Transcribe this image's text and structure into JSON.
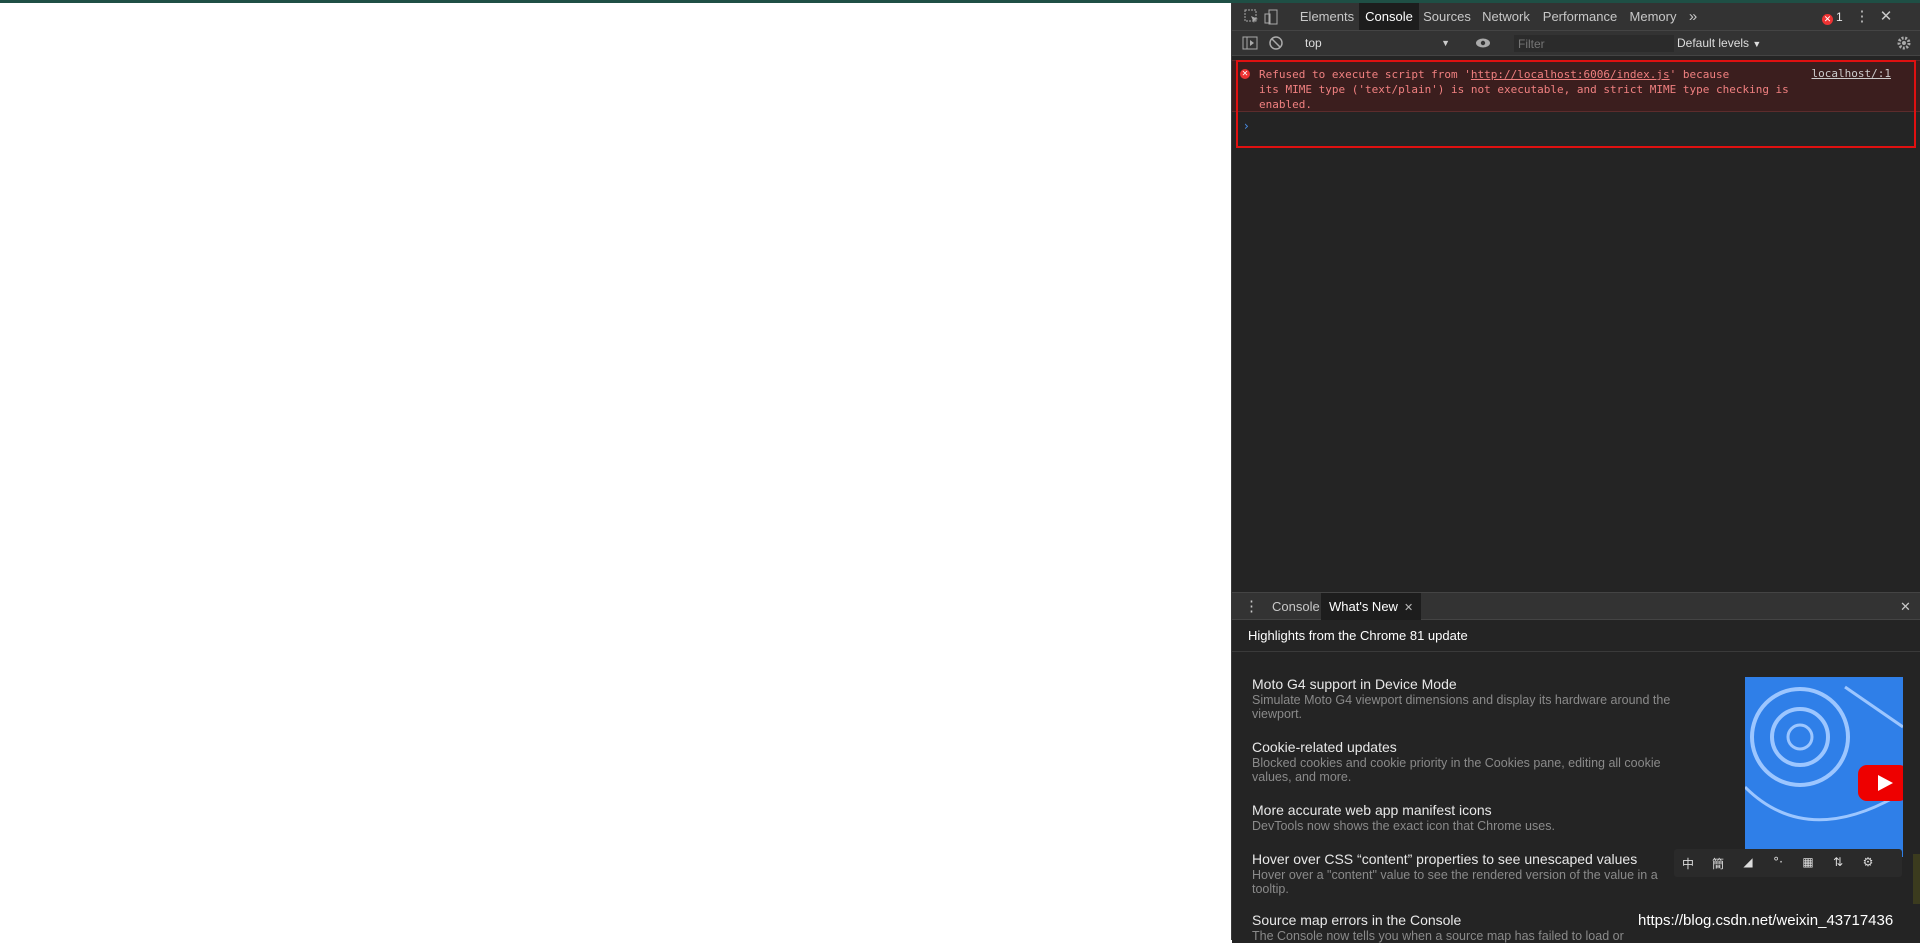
{
  "devtools": {
    "tabs": [
      "Elements",
      "Console",
      "Sources",
      "Network",
      "Performance",
      "Memory"
    ],
    "more_tabs": "»",
    "error_count": "1",
    "console_toolbar": {
      "context": "top",
      "filter_placeholder": "Filter",
      "levels": "Default levels"
    },
    "message": {
      "text_before": "Refused to execute script from '",
      "url": "http://localhost:6006/index.js",
      "text_after": "' because\nits MIME type ('text/plain') is not executable, and strict MIME type checking is\nenabled.",
      "source": "localhost/:1"
    },
    "prompt": "›",
    "drawer": {
      "tabs": [
        "Console",
        "What's New"
      ],
      "header": "Highlights from the Chrome 81 update",
      "features": [
        {
          "title": "Moto G4 support in Device Mode",
          "desc": "Simulate Moto G4 viewport dimensions and display its hardware around the viewport."
        },
        {
          "title": "Cookie-related updates",
          "desc": "Blocked cookies and cookie priority in the Cookies pane, editing all cookie values, and more."
        },
        {
          "title": "More accurate web app manifest icons",
          "desc": "DevTools now shows the exact icon that Chrome uses."
        },
        {
          "title": "Hover over CSS “content” properties to see unescaped values",
          "desc": "Hover over a \"content\" value to see the rendered version of the value in a tooltip."
        },
        {
          "title": "Source map errors in the Console",
          "desc": "The Console now tells you when a source map has failed to load or"
        }
      ]
    },
    "ime_toolbar": [
      "中",
      "簡",
      "◢",
      "°·",
      "▦",
      "⇅",
      "⚙"
    ]
  },
  "watermark": "https://blog.csdn.net/weixin_43717436",
  "colors": {
    "error": "#f08080",
    "highlight_box": "#e01010",
    "accent": "#2f7fe8"
  }
}
